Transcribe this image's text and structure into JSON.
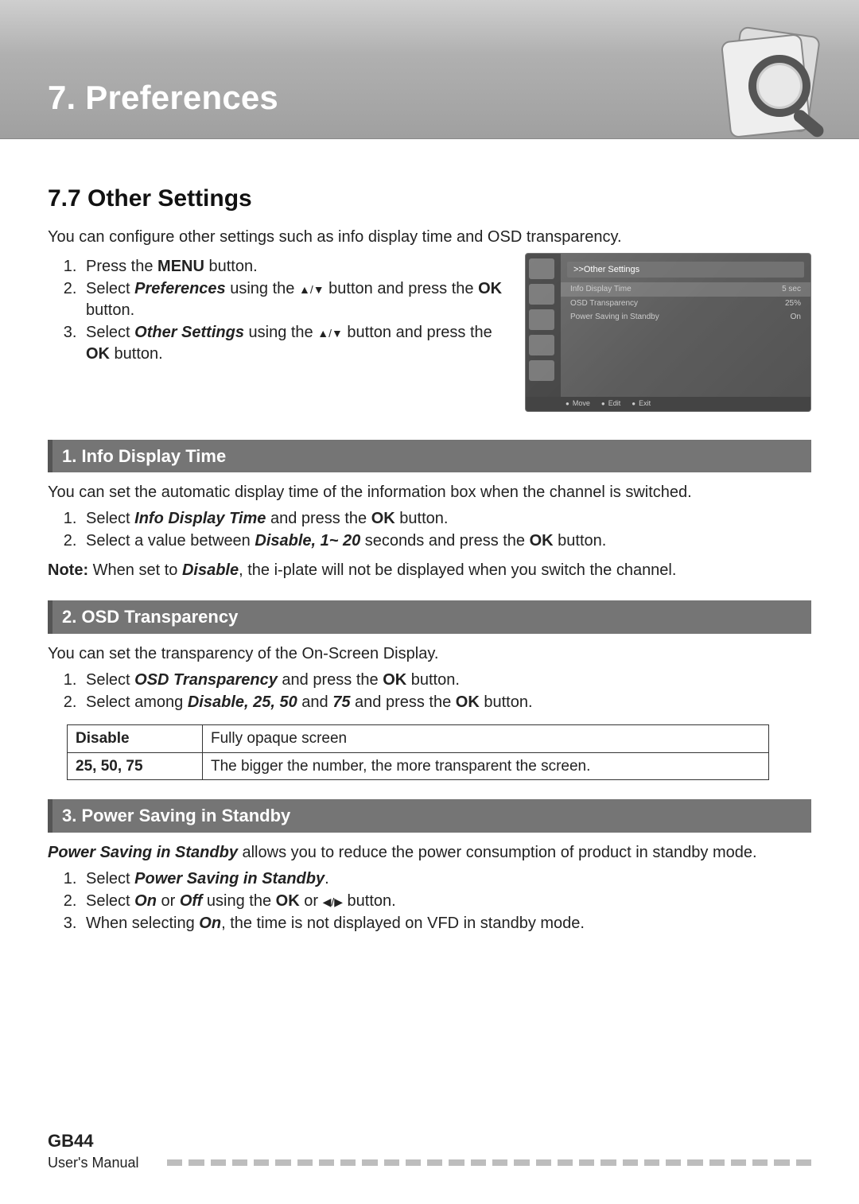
{
  "chapter": {
    "title": "7. Preferences"
  },
  "section": {
    "title": "7.7 Other Settings",
    "intro": "You can configure other settings such as info display time and OSD transparency."
  },
  "main_steps": [
    {
      "pre": "Press the ",
      "bold1": "MENU",
      "post1": " button."
    },
    {
      "pre": "Select ",
      "bi": "Preferences",
      "post1": " using the ",
      "arrows": "▲/▼",
      "post2": " button and press the ",
      "bold2": "OK",
      "post3": " button."
    },
    {
      "pre": "Select ",
      "bi": "Other Settings",
      "post1": " using the ",
      "arrows": "▲/▼",
      "post2": " button and press the ",
      "bold2": "OK",
      "post3": " button."
    }
  ],
  "screenshot": {
    "title": ">>Other Settings",
    "rows": [
      {
        "label": "Info Display Time",
        "value": "5 sec"
      },
      {
        "label": "OSD Transparency",
        "value": "25%"
      },
      {
        "label": "Power Saving in Standby",
        "value": "On"
      }
    ],
    "footer": [
      "Move",
      "Edit",
      "Exit"
    ]
  },
  "sub1": {
    "header": "1. Info Display Time",
    "intro": "You can set the automatic display time of the information box when the channel is switched.",
    "steps": [
      {
        "pre": "Select ",
        "bi": "Info Display Time",
        "mid": " and press the ",
        "bold": "OK",
        "post": " button."
      },
      {
        "pre": "Select a value between ",
        "bi": "Disable, 1~ 20",
        "mid": " seconds and press the ",
        "bold": "OK",
        "post": " button."
      }
    ],
    "note_label": "Note:",
    "note_pre": "   When set to ",
    "note_bi": "Disable",
    "note_post": ", the i-plate will not be displayed when you switch the channel."
  },
  "sub2": {
    "header": "2. OSD Transparency",
    "intro": "You can set the transparency of the On-Screen Display.",
    "steps": [
      {
        "pre": "Select ",
        "bi": "OSD Transparency",
        "mid": " and press the ",
        "bold": "OK",
        "post": " button."
      },
      {
        "pre": "Select among ",
        "bi": "Disable, 25, 50",
        "mid": " and ",
        "bi2": "75",
        "mid2": " and press the ",
        "bold": "OK",
        "post": " button."
      }
    ],
    "table": [
      {
        "k": "Disable",
        "v": "Fully opaque screen"
      },
      {
        "k": "25, 50, 75",
        "v": "The bigger the number, the more transparent the screen."
      }
    ]
  },
  "sub3": {
    "header": "3. Power Saving in Standby",
    "intro_bi": "Power Saving in Standby",
    "intro_post": " allows you to reduce the power consumption of product in standby mode.",
    "steps": [
      {
        "pre": "Select ",
        "bi": "Power Saving in Standby",
        "post": "."
      },
      {
        "pre": "Select ",
        "bi": "On",
        "mid": " or ",
        "bi2": "Off",
        "mid2": " using the ",
        "bold": "OK",
        "mid3": " or ",
        "arrows": "◀/▶",
        "post": " button."
      },
      {
        "pre": "When selecting ",
        "bi": "On",
        "post": ", the time is not displayed on VFD in standby mode."
      }
    ]
  },
  "footer": {
    "code": "GB44",
    "label": "User's Manual"
  }
}
